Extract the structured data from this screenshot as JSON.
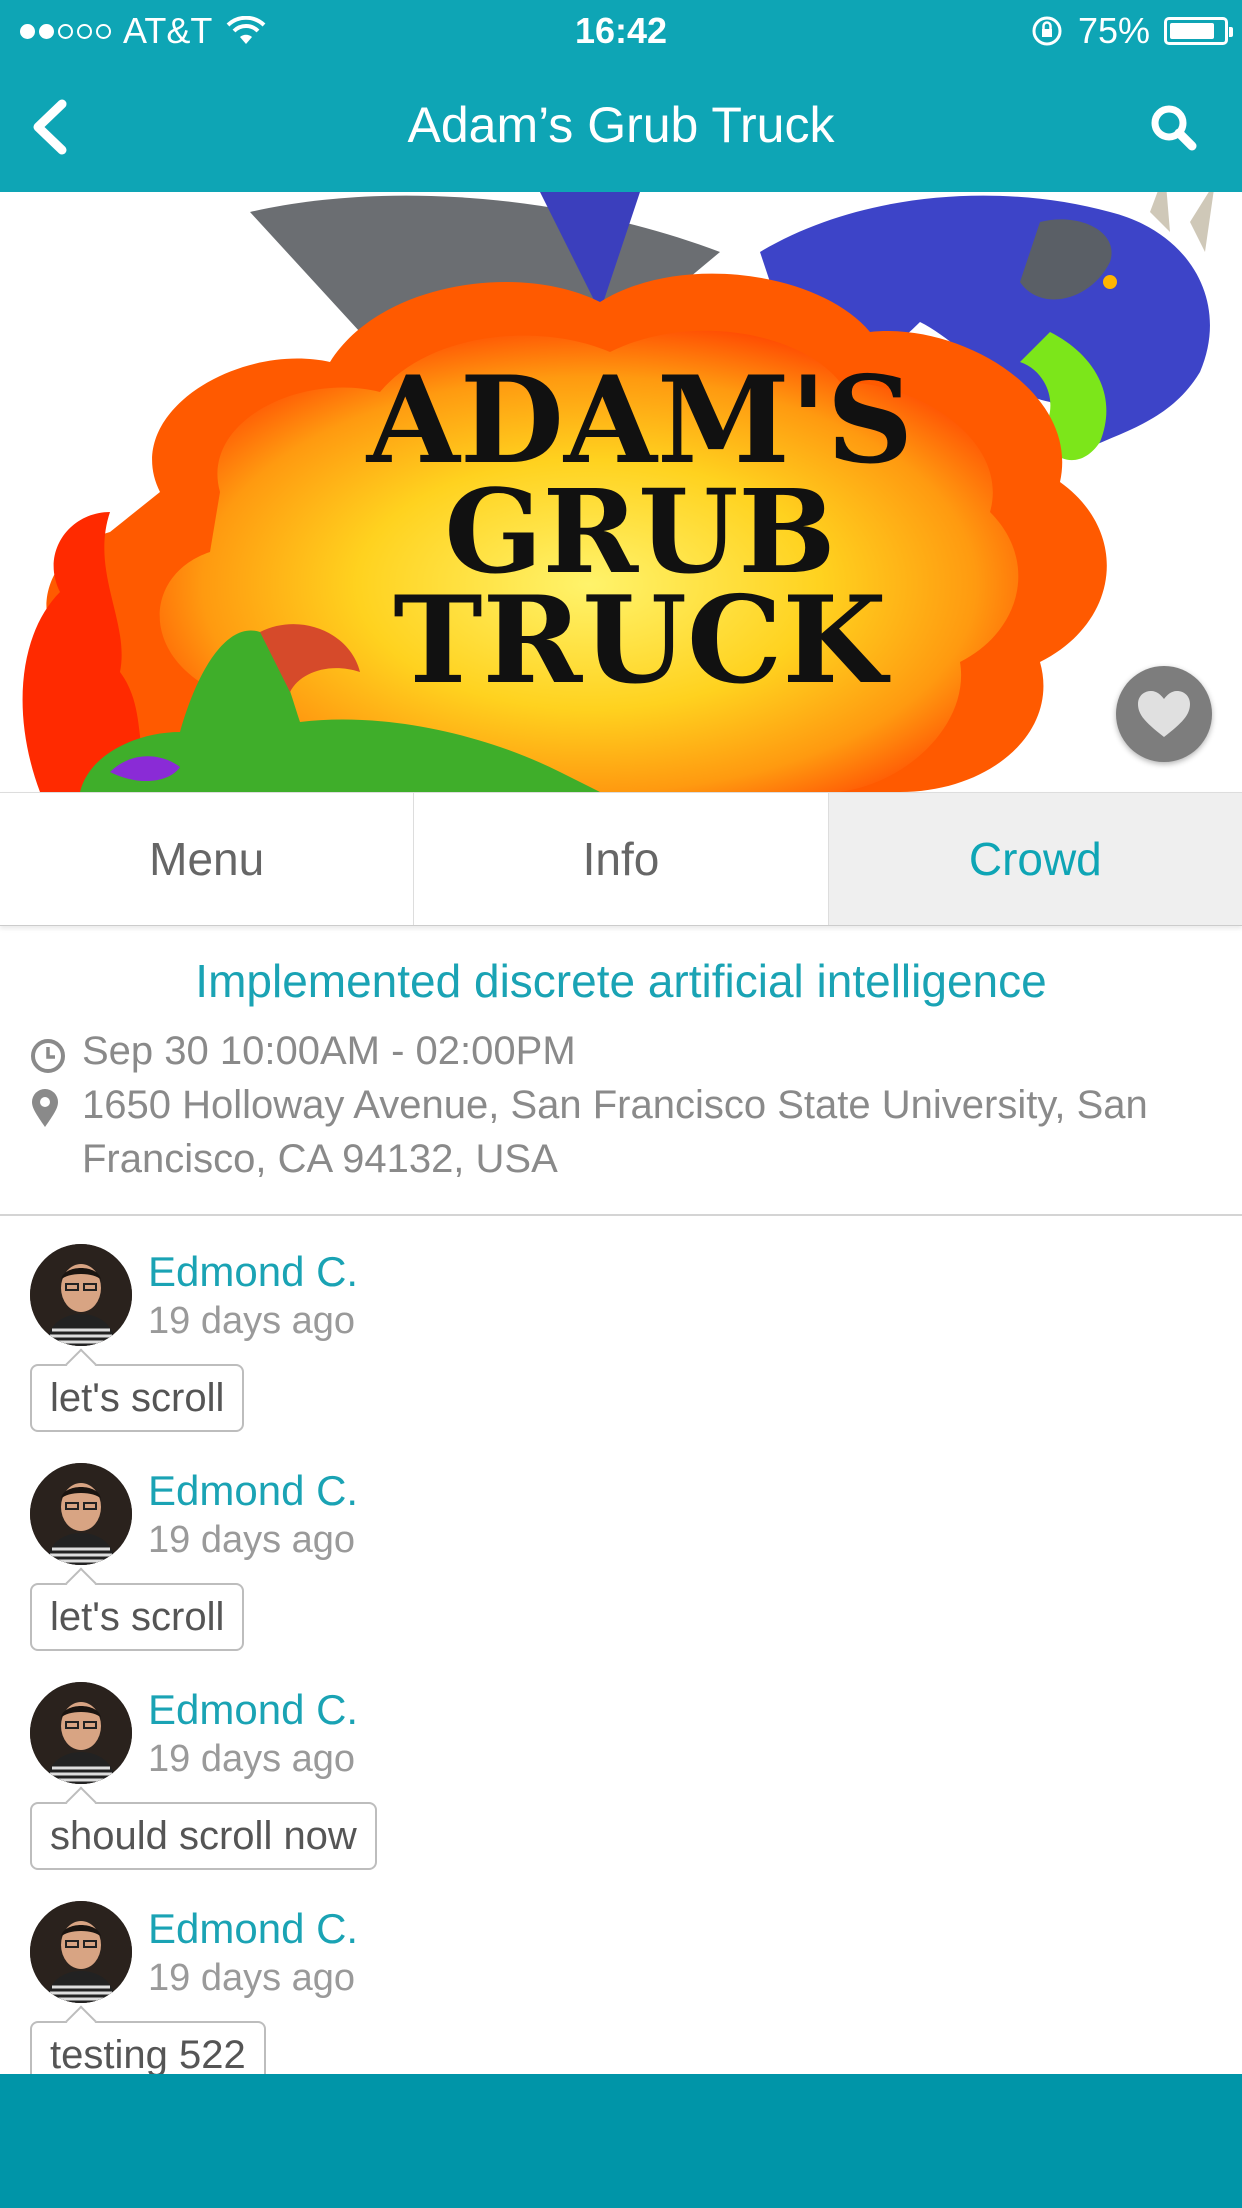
{
  "status_bar": {
    "carrier": "AT&T",
    "time": "16:42",
    "battery": "75%"
  },
  "nav": {
    "title": "Adam’s Grub Truck"
  },
  "hero": {
    "logo_lines": [
      "ADAM'S",
      "GRUB",
      "TRUCK"
    ]
  },
  "tabs": [
    {
      "label": "Menu",
      "active": false
    },
    {
      "label": "Info",
      "active": false
    },
    {
      "label": "Crowd",
      "active": true
    }
  ],
  "event": {
    "title": "Implemented discrete artificial intelligence",
    "time": "Sep 30 10:00AM - 02:00PM",
    "address": "1650 Holloway Avenue, San Francisco State University, San Francisco, CA 94132, USA"
  },
  "posts": [
    {
      "name": "Edmond C.",
      "time": "19 days ago",
      "message": "let's scroll"
    },
    {
      "name": "Edmond C.",
      "time": "19 days ago",
      "message": "let's scroll"
    },
    {
      "name": "Edmond C.",
      "time": "19 days ago",
      "message": "should scroll now"
    },
    {
      "name": "Edmond C.",
      "time": "19 days ago",
      "message": "testing 522"
    }
  ],
  "colors": {
    "accent": "#0ea5b5",
    "bottom_bar": "#0095a8",
    "favorite_button": "#7d7d7d"
  }
}
